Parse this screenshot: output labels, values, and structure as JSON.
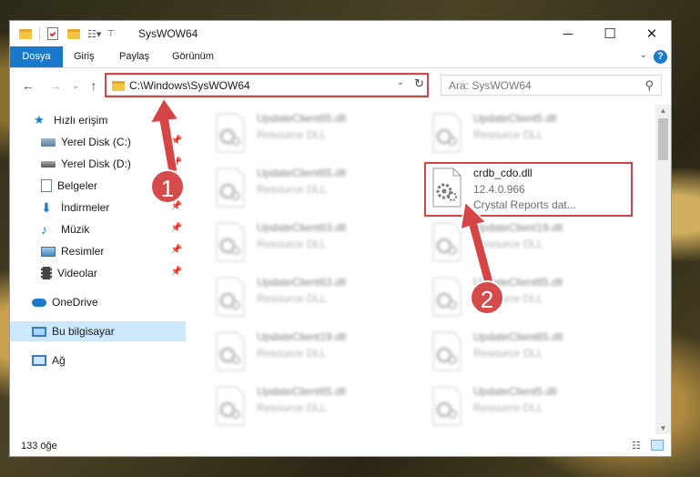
{
  "window": {
    "title": "SysWOW64",
    "controls": {
      "minimize": "─",
      "maximize": "☐",
      "close": "✕"
    }
  },
  "ribbon": {
    "tabs": [
      {
        "label": "Dosya"
      },
      {
        "label": "Giriş"
      },
      {
        "label": "Paylaş"
      },
      {
        "label": "Görünüm"
      }
    ],
    "help": "?"
  },
  "address": {
    "path": "C:\\Windows\\SysWOW64",
    "search_placeholder": "Ara: SysWOW64"
  },
  "sidebar": {
    "items": [
      {
        "label": "Hızlı erişim",
        "icon": "star-icon"
      },
      {
        "label": "Yerel Disk (C:)",
        "icon": "drive-icon",
        "pinned": true
      },
      {
        "label": "Yerel Disk (D:)",
        "icon": "drive-icon",
        "pinned": true
      },
      {
        "label": "Belgeler",
        "icon": "document-icon",
        "pinned": true
      },
      {
        "label": "İndirmeler",
        "icon": "download-icon",
        "pinned": true
      },
      {
        "label": "Müzik",
        "icon": "music-icon",
        "pinned": true
      },
      {
        "label": "Resimler",
        "icon": "pictures-icon",
        "pinned": true
      },
      {
        "label": "Videolar",
        "icon": "video-icon",
        "pinned": true
      },
      {
        "label": "OneDrive",
        "icon": "cloud-icon"
      },
      {
        "label": "Bu bilgisayar",
        "icon": "computer-icon",
        "selected": true
      },
      {
        "label": "Ağ",
        "icon": "network-icon"
      }
    ]
  },
  "files": {
    "highlighted": {
      "name": "crdb_cdo.dll",
      "version": "12.4.0.966",
      "description": "Crystal Reports dat..."
    },
    "left_column": [
      {
        "name": "UpdateClient65.dll",
        "description": "Resource DLL"
      },
      {
        "name": "UpdateClient65.dll",
        "description": "Resource DLL"
      },
      {
        "name": "UpdateClient63.dll",
        "description": "Resource DLL"
      },
      {
        "name": "UpdateClient63.dll",
        "description": "Resource DLL"
      },
      {
        "name": "UpdateClient19.dll",
        "description": "Resource DLL"
      },
      {
        "name": "UpdateClient65.dll",
        "description": "Resource DLL"
      }
    ],
    "right_column": [
      {
        "name": "UpdateClient5.dll",
        "description": "Resource DLL"
      },
      {
        "name": "UpdateClient19.dll",
        "description": "Resource DLL"
      },
      {
        "name": "UpdateClient65.dll",
        "description": "Resource DLL"
      },
      {
        "name": "UpdateClient65.dll",
        "description": "Resource DLL"
      },
      {
        "name": "UpdateClient5.dll",
        "description": "Resource DLL"
      }
    ]
  },
  "status": {
    "count": "133 öğe"
  },
  "annotations": {
    "step1": "1",
    "step2": "2"
  },
  "colors": {
    "accent": "#1979ca",
    "highlight": "#d64545",
    "selection": "#cce8ff"
  }
}
